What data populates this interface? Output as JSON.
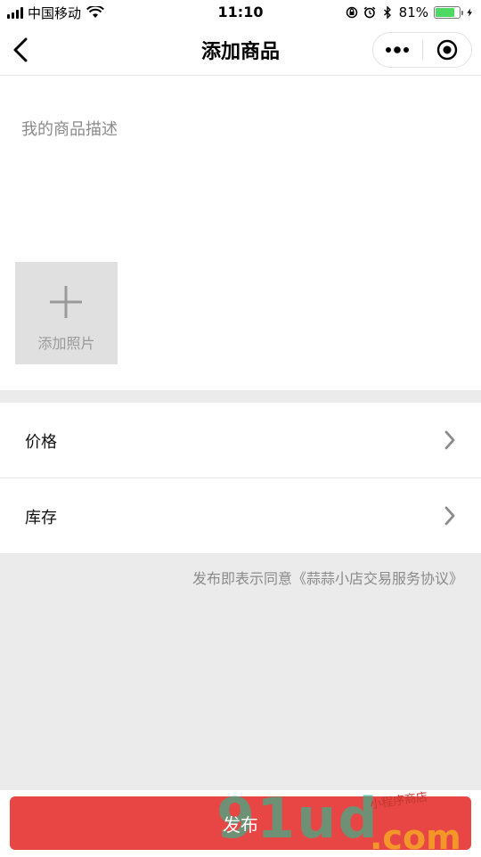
{
  "status_bar": {
    "carrier": "中国移动",
    "time": "11:10",
    "battery_percent": "81%",
    "battery_level": 0.81,
    "icons": [
      "signal-icon",
      "wifi-icon",
      "orientation-lock-icon",
      "alarm-icon",
      "bluetooth-icon",
      "charging-icon"
    ]
  },
  "nav": {
    "title": "添加商品",
    "back_icon": "chevron-left-icon",
    "menu_icon": "more-dots-icon",
    "close_icon": "target-circle-icon"
  },
  "form": {
    "description_placeholder": "我的商品描述",
    "description_value": "",
    "add_photo_label": "添加照片",
    "rows": [
      {
        "label": "价格"
      },
      {
        "label": "库存"
      }
    ]
  },
  "agreement_text": "发布即表示同意《蒜蒜小店交易服务协议》",
  "publish_label": "发布",
  "watermark": {
    "main": "91ud",
    "suffix": ".com",
    "small": "小程序商店"
  },
  "colors": {
    "accent": "#e84545",
    "background_gray": "#ebebeb",
    "placeholder": "#8a8a8a",
    "battery_fill": "#4cd964"
  }
}
